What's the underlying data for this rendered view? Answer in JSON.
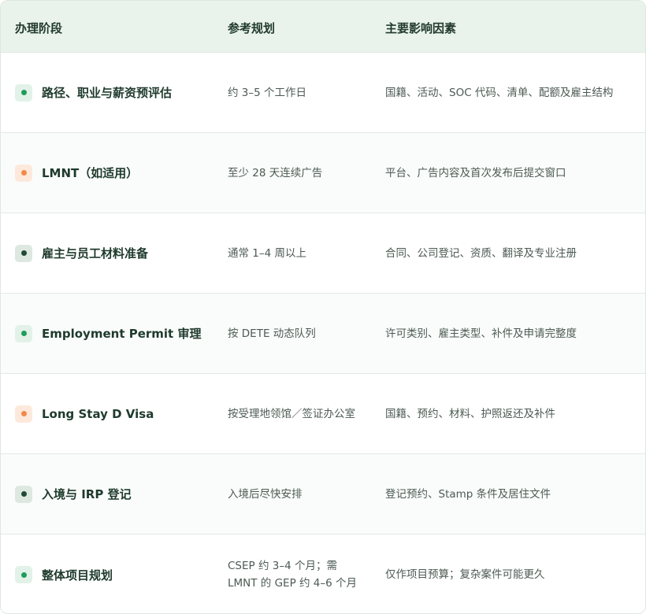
{
  "header": {
    "stage": "办理阶段",
    "timeline": "参考规划",
    "factors": "主要影响因素"
  },
  "colors": {
    "green_dot": "#1f9d5b",
    "green_bg": "#e2f2e8",
    "orange_dot": "#f2894a",
    "orange_bg": "#fde9dc",
    "dark_dot": "#1f4a36",
    "dark_bg": "#dde8e1"
  },
  "rows": [
    {
      "stage": "路径、职业与薪资预评估",
      "timeline": "约 3–5 个工作日",
      "factors": "国籍、活动、SOC 代码、清单、配额及雇主结构",
      "marker": "green"
    },
    {
      "stage": "LMNT（如适用）",
      "timeline": "至少 28 天连续广告",
      "factors": "平台、广告内容及首次发布后提交窗口",
      "marker": "orange"
    },
    {
      "stage": "雇主与员工材料准备",
      "timeline": "通常 1–4 周以上",
      "factors": "合同、公司登记、资质、翻译及专业注册",
      "marker": "dark"
    },
    {
      "stage": "Employment Permit 审理",
      "timeline": "按 DETE 动态队列",
      "factors": "许可类别、雇主类型、补件及申请完整度",
      "marker": "green"
    },
    {
      "stage": "Long Stay D Visa",
      "timeline": "按受理地领馆／签证办公室",
      "factors": "国籍、预约、材料、护照返还及补件",
      "marker": "orange"
    },
    {
      "stage": "入境与 IRP 登记",
      "timeline": "入境后尽快安排",
      "factors": "登记预约、Stamp 条件及居住文件",
      "marker": "dark"
    },
    {
      "stage": "整体项目规划",
      "timeline": "CSEP 约 3–4 个月；需 LMNT 的 GEP 约 4–6 个月",
      "factors": "仅作项目预算；复杂案件可能更久",
      "marker": "green"
    }
  ]
}
